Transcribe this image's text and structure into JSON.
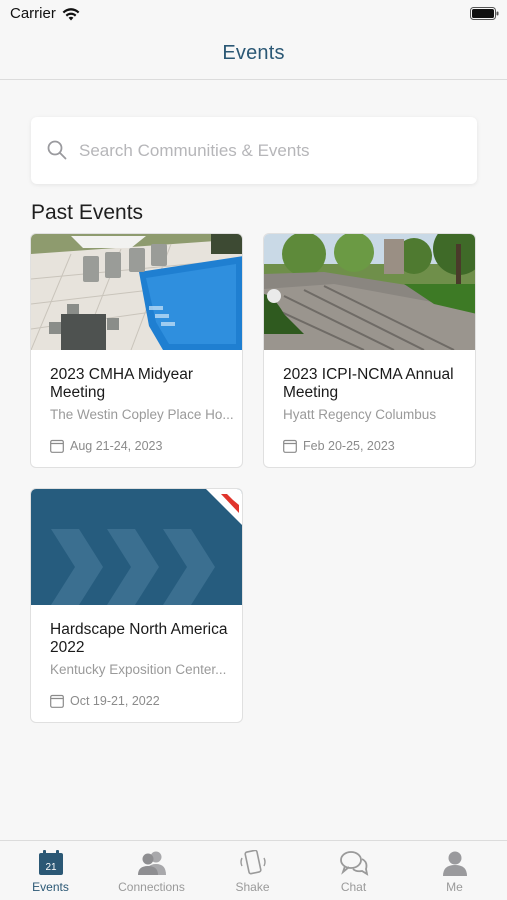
{
  "status_bar": {
    "carrier": "Carrier"
  },
  "nav": {
    "title": "Events"
  },
  "search": {
    "placeholder": "Search Communities & Events"
  },
  "section": {
    "title": "Past Events"
  },
  "events": [
    {
      "title": "2023 CMHA Midyear Meeting",
      "venue": "The Westin Copley Place Ho...",
      "date": "Aug 21-24, 2023",
      "image": "pool-icon"
    },
    {
      "title": "2023 ICPI-NCMA Annual Meeting",
      "venue": "Hyatt Regency Columbus",
      "date": "Feb 20-25, 2023",
      "image": "park-icon"
    },
    {
      "title": "Hardscape North America 2022",
      "venue": "Kentucky Exposition Center...",
      "date": "Oct 19-21, 2022",
      "image": "hardscape-logo-icon"
    }
  ],
  "tabs": [
    {
      "label": "Events",
      "icon": "calendar-icon",
      "badge": "21",
      "active": true
    },
    {
      "label": "Connections",
      "icon": "people-icon",
      "active": false
    },
    {
      "label": "Shake",
      "icon": "phone-shake-icon",
      "active": false
    },
    {
      "label": "Chat",
      "icon": "chat-icon",
      "active": false
    },
    {
      "label": "Me",
      "icon": "person-icon",
      "active": false
    }
  ],
  "colors": {
    "accent": "#2b5875",
    "hardscape_blue": "#265c7e",
    "hardscape_red": "#e0342c"
  }
}
